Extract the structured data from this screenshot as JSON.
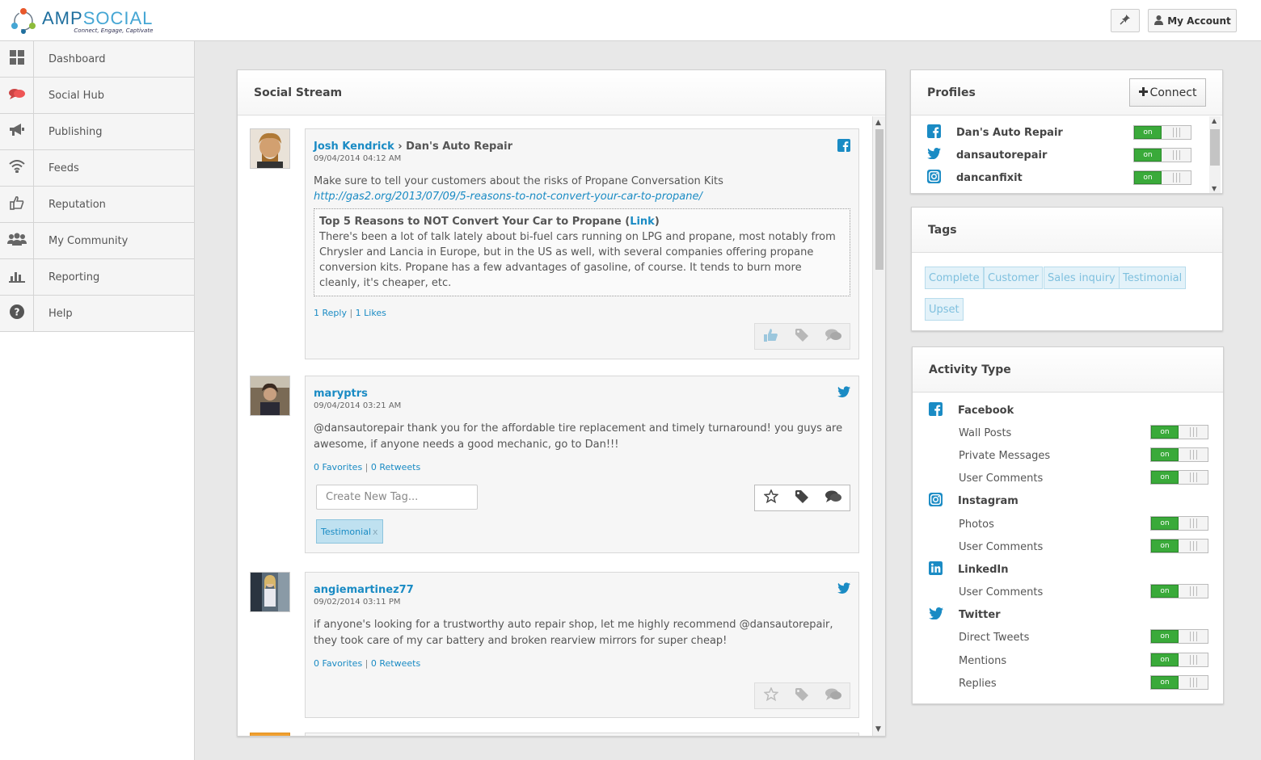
{
  "header": {
    "logo_name_a": "AMP",
    "logo_name_b": "SOCIAL",
    "logo_tagline": "Connect, Engage, Captivate",
    "account_label": "My Account"
  },
  "sidebar": {
    "items": [
      {
        "label": "Dashboard",
        "icon": "dashboard-icon"
      },
      {
        "label": "Social Hub",
        "icon": "chat-bubble-icon"
      },
      {
        "label": "Publishing",
        "icon": "megaphone-icon"
      },
      {
        "label": "Feeds",
        "icon": "wifi-icon"
      },
      {
        "label": "Reputation",
        "icon": "thumbs-up-icon"
      },
      {
        "label": "My Community",
        "icon": "people-icon"
      },
      {
        "label": "Reporting",
        "icon": "bar-chart-icon"
      },
      {
        "label": "Help",
        "icon": "question-icon"
      }
    ]
  },
  "stream": {
    "title": "Social Stream",
    "posts": [
      {
        "author": "Josh Kendrick",
        "target": "Dan's Auto Repair",
        "network": "facebook",
        "time": "09/04/2014 04:12 AM",
        "message": "Make sure to tell your customers about the risks of Propane Conversation Kits",
        "link": "http://gas2.org/2013/07/09/5-reasons-to-not-convert-your-car-to-propane/",
        "embed_title": "Top 5 Reasons to NOT Convert Your Car to Propane (",
        "embed_link": "Link",
        "embed_title_end": ")",
        "embed_text": "There's been a lot of talk lately about bi-fuel cars running on LPG and propane, most notably from Chrysler and Lancia in Europe, but in the US as well, with several companies offering propane conversion kits. Propane has a few advantages of gasoline, of course. It tends to burn more cleanly, it's cheaper, etc.",
        "stat1": "1 Reply",
        "stat2": "1 Likes"
      },
      {
        "author": "maryptrs",
        "network": "twitter",
        "time": "09/04/2014 03:21 AM",
        "message": "@dansautorepair thank you for the affordable tire replacement and timely turnaround! you guys are awesome, if anyone needs a good mechanic, go to Dan!!!",
        "stat1": "0 Favorites",
        "stat2": "0 Retweets",
        "tag_placeholder": "Create New Tag...",
        "tag_chip": "Testimonial",
        "tag_chip_x": "x"
      },
      {
        "author": "angiemartinez77",
        "network": "twitter",
        "time": "09/02/2014 03:11 PM",
        "message": "if anyone's looking for a trustworthy auto repair shop, let me highly recommend @dansautorepair, they took care of my car battery and broken rearview mirrors for super cheap!",
        "stat1": "0 Favorites",
        "stat2": "0 Retweets"
      }
    ]
  },
  "profiles": {
    "title": "Profiles",
    "connect_label": "Connect",
    "items": [
      {
        "name": "Dan's Auto Repair",
        "network": "facebook",
        "state": "on"
      },
      {
        "name": "dansautorepair",
        "network": "twitter",
        "state": "on"
      },
      {
        "name": "dancanfixit",
        "network": "instagram",
        "state": "on"
      }
    ]
  },
  "tags": {
    "title": "Tags",
    "items": [
      "Complete",
      "Customer",
      "Sales inquiry",
      "Testimonial",
      "Upset"
    ]
  },
  "activity": {
    "title": "Activity Type",
    "facebook": {
      "label": "Facebook",
      "items": [
        "Wall Posts",
        "Private Messages",
        "User Comments"
      ]
    },
    "instagram": {
      "label": "Instagram",
      "items": [
        "Photos",
        "User Comments"
      ]
    },
    "linkedin": {
      "label": "LinkedIn",
      "items": [
        "User Comments"
      ]
    },
    "twitter": {
      "label": "Twitter",
      "items": [
        "Direct Tweets",
        "Mentions",
        "Replies"
      ]
    },
    "toggle_label": "on"
  },
  "colors": {
    "accent": "#1a8bc4",
    "toggle_on": "#3aaa3a",
    "facebook": "#3b6db4",
    "twitter": "#1da1f2"
  }
}
